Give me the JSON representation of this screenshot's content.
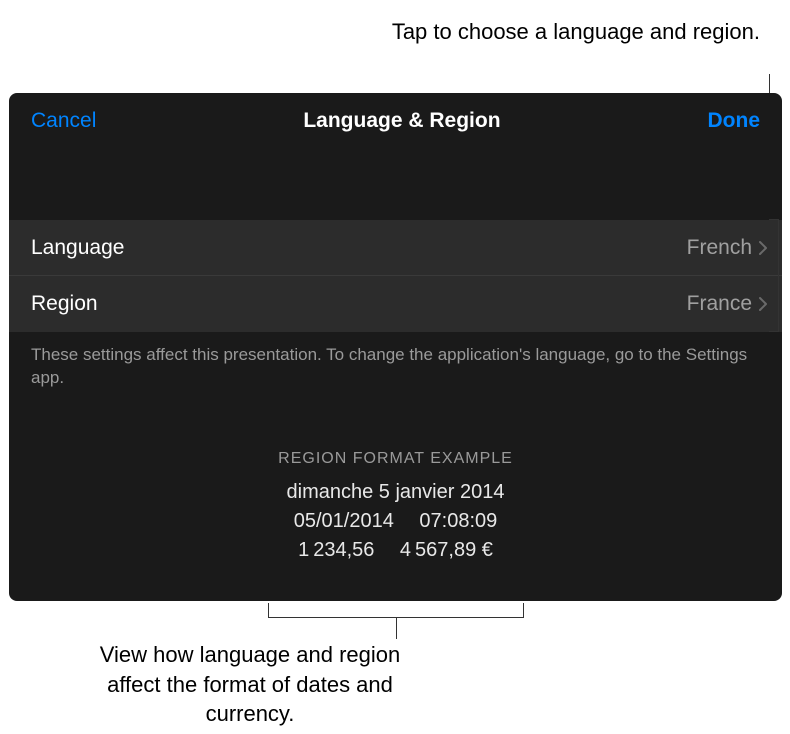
{
  "callouts": {
    "top": "Tap to choose a language and region.",
    "bottom": "View how language and region affect the format of dates and currency."
  },
  "header": {
    "cancel": "Cancel",
    "title": "Language & Region",
    "done": "Done"
  },
  "rows": {
    "language": {
      "label": "Language",
      "value": "French"
    },
    "region": {
      "label": "Region",
      "value": "France"
    }
  },
  "footerNote": "These settings affect this presentation. To change the application's language, go to the Settings app.",
  "example": {
    "header": "REGION FORMAT EXAMPLE",
    "line1": "dimanche 5 janvier 2014",
    "line2": "05/01/2014  07:08:09",
    "line3": "1 234,56  4 567,89 €"
  }
}
